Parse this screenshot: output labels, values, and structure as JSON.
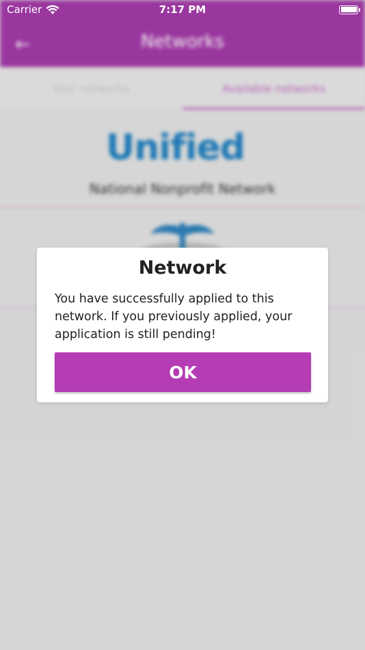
{
  "status_bar": {
    "carrier": "Carrier",
    "time": "7:17 PM"
  },
  "header": {
    "title": "Networks",
    "back_icon": "back-arrow-icon"
  },
  "tabs": [
    {
      "label": "Your networks",
      "active": false
    },
    {
      "label": "Available networks",
      "active": true
    }
  ],
  "networks": [
    {
      "logo_text": "Unified",
      "name": "National Nonprofit Network"
    },
    {
      "logo_text": "",
      "name": ""
    }
  ],
  "dialog": {
    "title": "Network",
    "message": "You have successfully applied to this network. If you previously applied, your application is still pending!",
    "ok_label": "OK"
  },
  "colors": {
    "primary": "#a33aa8",
    "button": "#b43db5",
    "accent_tab": "#c06cc4"
  }
}
